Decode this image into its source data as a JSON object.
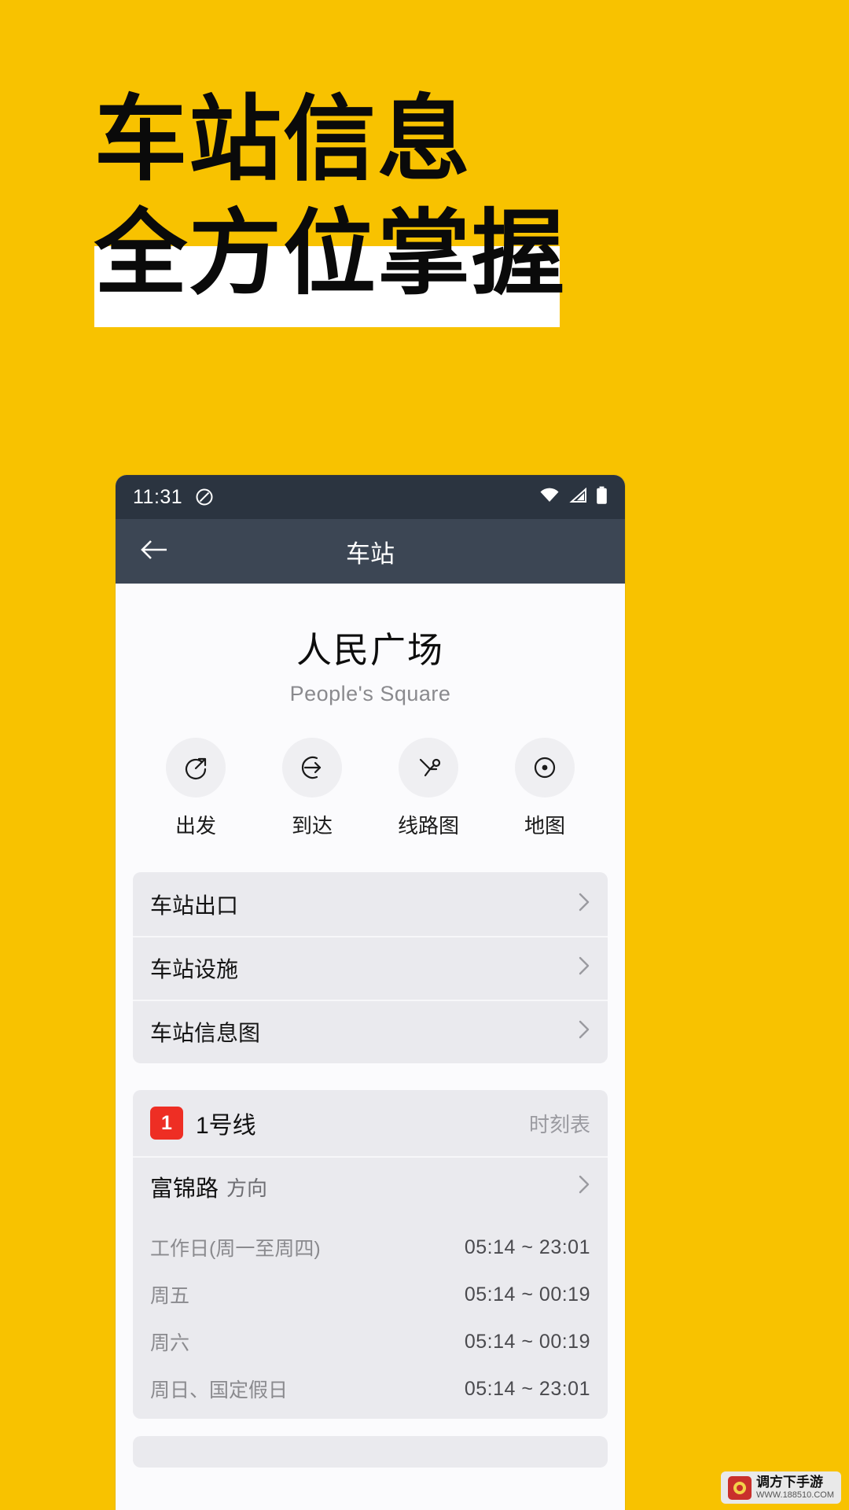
{
  "poster": {
    "background_color": "#F8C200",
    "headline_line1": "车站信息",
    "headline_line2": "全方位掌握",
    "highlight_band_color": "#FFFFFF"
  },
  "phone": {
    "status_bar": {
      "time": "11:31",
      "icons": [
        "do-not-disturb-icon",
        "wifi-icon",
        "signal-icon",
        "battery-icon"
      ]
    },
    "app_bar": {
      "back_icon": "arrow-left-icon",
      "title": "车站"
    },
    "station": {
      "name_cn": "人民广场",
      "name_en": "People's Square"
    },
    "actions": [
      {
        "icon": "depart-icon",
        "label": "出发"
      },
      {
        "icon": "arrive-icon",
        "label": "到达"
      },
      {
        "icon": "route-map-icon",
        "label": "线路图"
      },
      {
        "icon": "map-pin-icon",
        "label": "地图"
      }
    ],
    "info_rows": [
      {
        "label": "车站出口",
        "chevron": "chevron-right-icon"
      },
      {
        "label": "车站设施",
        "chevron": "chevron-right-icon"
      },
      {
        "label": "车站信息图",
        "chevron": "chevron-right-icon"
      }
    ],
    "line_section": {
      "badge": "1",
      "badge_color": "#EE2E24",
      "line_name": "1号线",
      "schedule_label": "时刻表",
      "direction": {
        "name": "富锦路",
        "suffix": "方向",
        "chevron": "chevron-right-icon"
      },
      "timetable": [
        {
          "day": "工作日(周一至周四)",
          "time": "05:14 ~ 23:01"
        },
        {
          "day": "周五",
          "time": "05:14 ~ 00:19"
        },
        {
          "day": "周六",
          "time": "05:14 ~ 00:19"
        },
        {
          "day": "周日、国定假日",
          "time": "05:14 ~ 23:01"
        }
      ]
    }
  },
  "watermark": {
    "title": "调方下手游",
    "url": "WWW.188510.COM"
  }
}
